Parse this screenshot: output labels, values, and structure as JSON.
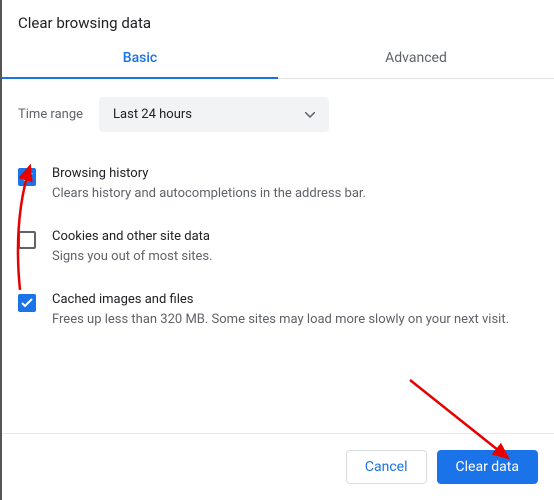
{
  "title": "Clear browsing data",
  "tabs": {
    "basic": "Basic",
    "advanced": "Advanced"
  },
  "timerange": {
    "label": "Time range",
    "selected": "Last 24 hours"
  },
  "options": [
    {
      "checked": true,
      "title": "Browsing history",
      "desc": "Clears history and autocompletions in the address bar."
    },
    {
      "checked": false,
      "title": "Cookies and other site data",
      "desc": "Signs you out of most sites."
    },
    {
      "checked": true,
      "title": "Cached images and files",
      "desc": "Frees up less than 320 MB. Some sites may load more slowly on your next visit."
    }
  ],
  "buttons": {
    "cancel": "Cancel",
    "clear": "Clear data"
  }
}
